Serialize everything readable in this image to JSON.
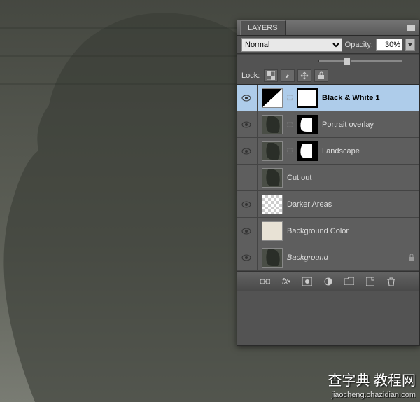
{
  "panel": {
    "title": "LAYERS"
  },
  "blendMode": "Normal",
  "opacity": {
    "label": "Opacity:",
    "value": "30%"
  },
  "lock": {
    "label": "Lock:"
  },
  "layers": [
    {
      "name": "Black & White 1",
      "visible": true,
      "selected": true,
      "type": "adjustment",
      "hasMask": true
    },
    {
      "name": "Portrait overlay",
      "visible": true,
      "selected": false,
      "type": "image",
      "hasMask": true
    },
    {
      "name": "Landscape",
      "visible": true,
      "selected": false,
      "type": "image",
      "hasMask": true
    },
    {
      "name": "Cut out",
      "visible": false,
      "selected": false,
      "type": "image",
      "hasMask": false
    },
    {
      "name": "Darker Areas",
      "visible": true,
      "selected": false,
      "type": "checker",
      "hasMask": false
    },
    {
      "name": "Background Color",
      "visible": true,
      "selected": false,
      "type": "bgcolor",
      "hasMask": false
    },
    {
      "name": "Background",
      "visible": true,
      "selected": false,
      "type": "image",
      "hasMask": false,
      "locked": true,
      "italic": true
    }
  ],
  "watermark": {
    "main": "查字典 教程网",
    "sub": "jiaocheng.chazidian.com"
  }
}
